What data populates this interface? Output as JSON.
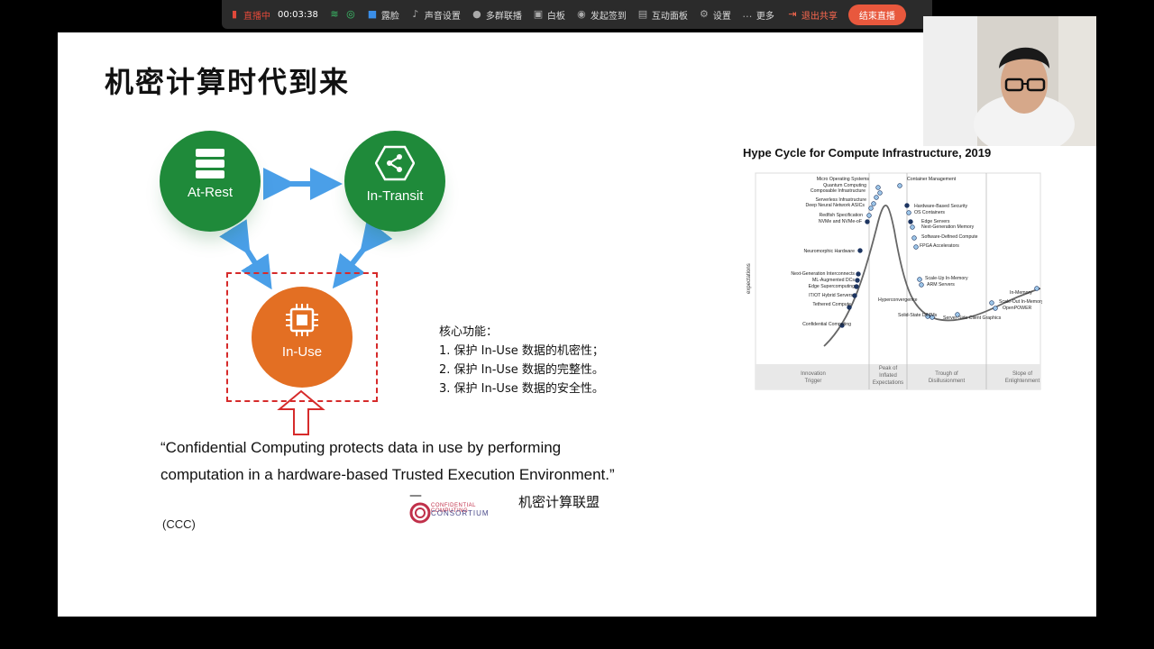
{
  "toolbar": {
    "live_label": "直播中",
    "timer": "00:03:38",
    "items": [
      "露脸",
      "声音设置",
      "多群联播",
      "白板",
      "发起签到",
      "互动面板",
      "设置",
      "更多"
    ],
    "exit_label": "退出共享",
    "end_label": "结束直播"
  },
  "slide": {
    "title": "机密计算时代到来",
    "circles": {
      "rest": "At-Rest",
      "transit": "In-Transit",
      "use": "In-Use"
    },
    "core_title": "核心功能：",
    "core_items": [
      "1. 保护 In-Use 数据的机密性；",
      "2. 保护 In-Use 数据的完整性。",
      "3. 保护 In-Use 数据的安全性。"
    ],
    "quote": "“Confidential Computing protects data in use by performing computation in a hardware-based Trusted Execution Environment.”",
    "dash": "—",
    "consortium": "机密计算联盟",
    "ccc": "(CCC)",
    "logo_line1": "CONFIDENTIAL COMPUTING",
    "logo_line2": "CONSORTIUM"
  },
  "hype": {
    "title": "Hype Cycle for Compute Infrastructure, 2019",
    "ylabel": "expectations",
    "phases": [
      "Innovation Trigger",
      "Peak of Inflated Expectations",
      "Trough of Disillusionment",
      "Slope of Enlightenment"
    ],
    "labels_left": [
      "Micro Operating Systems",
      "Quantum Computing",
      "Composable Infrastructure",
      "Serverless Infrastructure",
      "Deep Neural Network ASICs",
      "Redfish Specification",
      "NVMe and NVMe-oF",
      "Neuromorphic Hardware",
      "Next-Generation Interconnects",
      "ML-Augmented DCs",
      "Edge Supercomputing",
      "IT/OT Hybrid Servers",
      "Tethered Compute",
      "Confidential Computing"
    ],
    "labels_right": [
      "Container Management",
      "Hardware-Based Security",
      "OS Containers",
      "Edge Servers",
      "Next-Generation Memory",
      "Software-Defined Compute",
      "FPGA Accelerators",
      "Scale-Up In-Memory",
      "ARM Servers",
      "Hyperconvergence",
      "Solid-State DIMMs",
      "Server-Side Client Graphics",
      "Scale-Out In-Memory",
      "OpenPOWER",
      "In-Memory"
    ]
  }
}
